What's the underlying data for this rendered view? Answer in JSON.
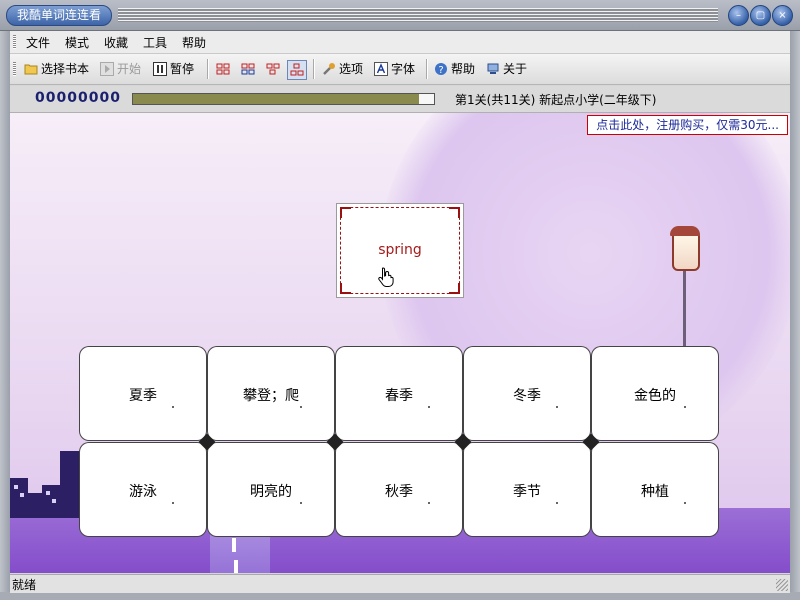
{
  "window": {
    "title": "我酷单词连连看",
    "buttons": [
      "minimize",
      "restore",
      "close"
    ]
  },
  "menu": {
    "items": [
      "文件",
      "模式",
      "收藏",
      "工具",
      "帮助"
    ]
  },
  "toolbar": {
    "select_book": "选择书本",
    "start": "开始",
    "pause": "暂停",
    "options": "选项",
    "font": "字体",
    "help": "帮助",
    "about": "关于"
  },
  "status": {
    "score": "00000000",
    "progress_fraction": 0.95,
    "level_text": "第1关(共11关)  新起点小学(二年级下)"
  },
  "promo": {
    "register_text": "点击此处，注册购买，仅需30元..."
  },
  "game": {
    "target_word": "spring",
    "answers": [
      [
        "夏季",
        "攀登；爬",
        "春季",
        "冬季",
        "金色的"
      ],
      [
        "游泳",
        "明亮的",
        "秋季",
        "季节",
        "种植"
      ]
    ]
  },
  "statusbar": {
    "text": "就绪"
  },
  "colors": {
    "accent": "#3d64a8",
    "target_red": "#a41b1b",
    "score_blue": "#1a1f6e",
    "progress": "#8a8a4e"
  }
}
